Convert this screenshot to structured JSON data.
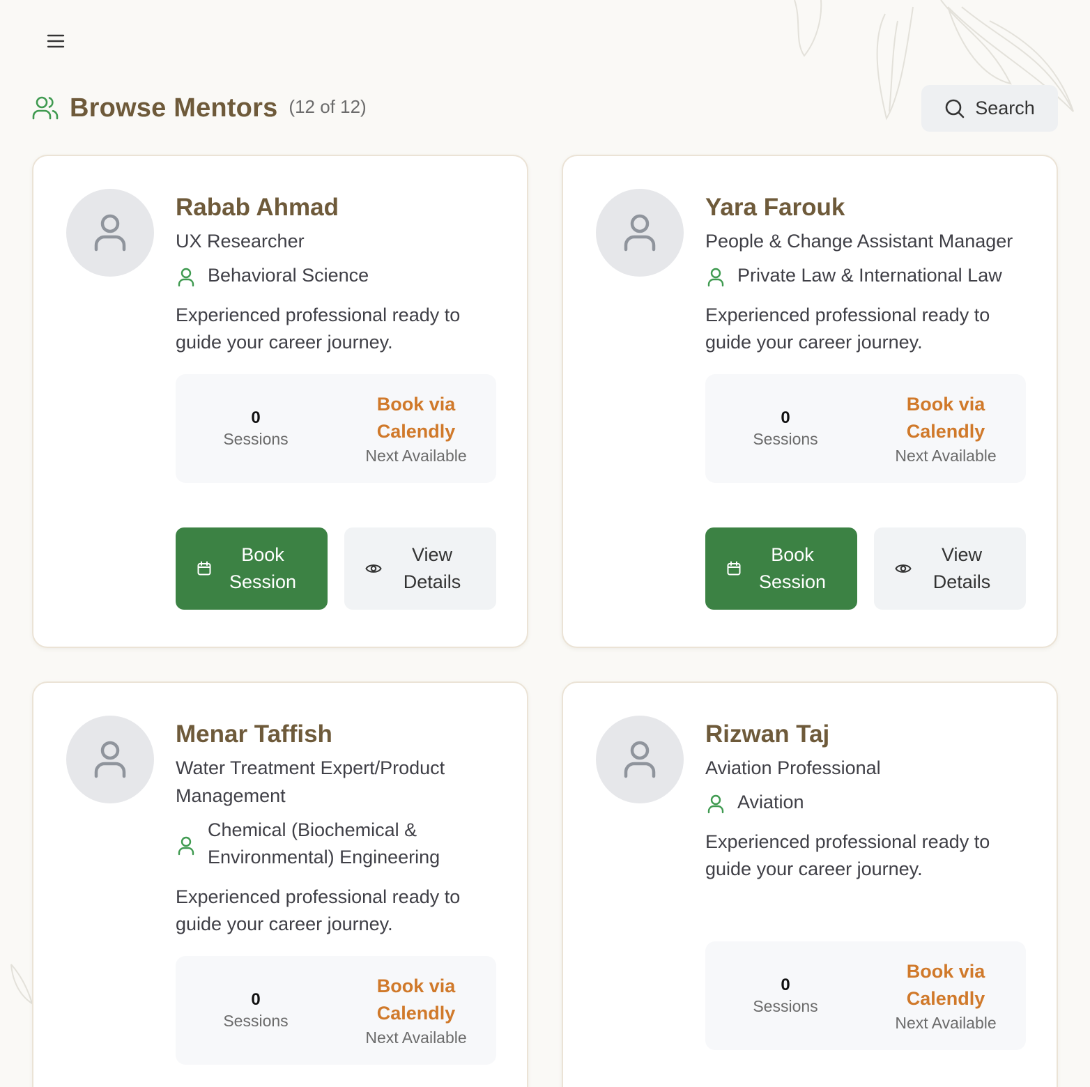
{
  "header": {
    "title": "Browse Mentors",
    "count": "(12 of 12)",
    "search_label": "Search"
  },
  "mentors": [
    {
      "name": "Rabab Ahmad",
      "role": "UX Researcher",
      "field": "Behavioral Science",
      "description": "Experienced professional ready to guide your career journey.",
      "sessions_count": "0",
      "sessions_label": "Sessions",
      "booking_link": "Book via Calendly",
      "booking_caption": "Next Available",
      "book_button": "Book Session",
      "details_button": "View Details"
    },
    {
      "name": "Yara Farouk",
      "role": "People & Change Assistant Manager",
      "field": "Private Law & International Law",
      "description": "Experienced professional ready to guide your career journey.",
      "sessions_count": "0",
      "sessions_label": "Sessions",
      "booking_link": "Book via Calendly",
      "booking_caption": "Next Available",
      "book_button": "Book Session",
      "details_button": "View Details"
    },
    {
      "name": "Menar Taffish",
      "role": "Water Treatment Expert/Product Management",
      "field": "Chemical (Biochemical & Environmental) Engineering",
      "description": "Experienced professional ready to guide your career journey.",
      "sessions_count": "0",
      "sessions_label": "Sessions",
      "booking_link": "Book via Calendly",
      "booking_caption": "Next Available"
    },
    {
      "name": "Rizwan Taj",
      "role": "Aviation Professional",
      "field": "Aviation",
      "description": "Experienced professional ready to guide your career journey.",
      "sessions_count": "0",
      "sessions_label": "Sessions",
      "booking_link": "Book via Calendly",
      "booking_caption": "Next Available"
    }
  ],
  "icons": {
    "menu": "hamburger-menu-icon",
    "header": "users-icon",
    "search": "search-icon",
    "avatar": "user-placeholder-icon",
    "field": "user-icon",
    "book": "calendar-icon",
    "details": "eye-icon"
  },
  "colors": {
    "background": "#faf9f6",
    "title": "#6e5a3a",
    "accent_green": "#3c8244",
    "icon_green": "#3f9a50",
    "calendly_orange": "#d0792a"
  }
}
